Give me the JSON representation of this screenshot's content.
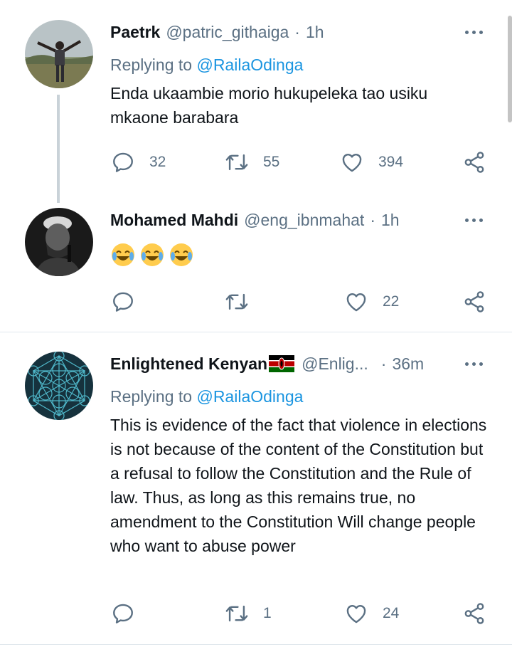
{
  "tweets": [
    {
      "name": "Paetrk",
      "handle": "@patric_githaiga",
      "time": "1h",
      "replying_label": "Replying to",
      "replying_to": "@RailaOdinga",
      "text": "Enda ukaambie morio hukupeleka tao usiku mkaone barabara",
      "reply_count": "32",
      "retweet_count": "55",
      "like_count": "394"
    },
    {
      "name": "Mohamed Mahdi",
      "handle": "@eng_ibnmahat",
      "time": "1h",
      "text_emoji": "face-with-tears-of-joy ×3",
      "reply_count": "",
      "retweet_count": "",
      "like_count": "22"
    },
    {
      "name": "Enlightened Kenyan",
      "handle": "@Enlig...",
      "time": "36m",
      "replying_label": "Replying to",
      "replying_to": "@RailaOdinga",
      "text": "This is evidence of the fact that violence in elections is not because of  the content of the Constitution but a refusal to follow the Constitution and the Rule of law. Thus, as long as this remains true, no amendment to the Constitution Will change people who want to abuse power",
      "reply_count": "",
      "retweet_count": "1",
      "like_count": "24"
    }
  ],
  "colors": {
    "text": "#0f1419",
    "secondary": "#5b7083",
    "link": "#1b95e0",
    "thread_line": "#c9d2d8"
  },
  "icons": [
    "reply-icon",
    "retweet-icon",
    "like-icon",
    "share-icon",
    "more-icon",
    "kenya-flag-icon",
    "tears-of-joy-emoji"
  ]
}
